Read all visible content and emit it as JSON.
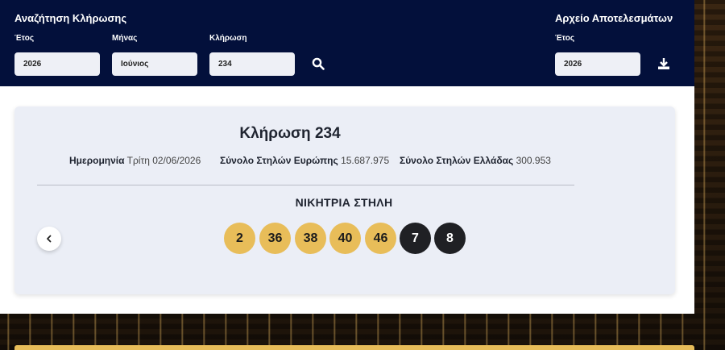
{
  "search": {
    "title": "Αναζήτηση Κλήρωσης",
    "year_label": "Έτος",
    "year_value": "2026",
    "month_label": "Μήνας",
    "month_value": "Ιούνιος",
    "draw_label": "Κλήρωση",
    "draw_value": "234",
    "search_icon": "search-icon"
  },
  "archive": {
    "title": "Αρχείο Αποτελεσμάτων",
    "year_label": "Έτος",
    "year_value": "2026",
    "download_icon": "download-icon"
  },
  "draw": {
    "title": "Κλήρωση 234",
    "date_label": "Ημερομηνία",
    "date_value": "Τρίτη 02/06/2026",
    "europe_label": "Σύνολο Στηλών Ευρώπης",
    "europe_value": "15.687.975",
    "greece_label": "Σύνολο Στηλών Ελλάδας",
    "greece_value": "300.953",
    "winning_title": "ΝΙΚΗΤΡΙΑ ΣΤΗΛΗ",
    "main_numbers": [
      "2",
      "36",
      "38",
      "40",
      "46"
    ],
    "bonus_numbers": [
      "7",
      "8"
    ],
    "prev_icon": "chevron-left-icon"
  },
  "colors": {
    "header_bg": "#03103b",
    "main_ball": "#e8bd59",
    "bonus_ball": "#1f2024"
  }
}
